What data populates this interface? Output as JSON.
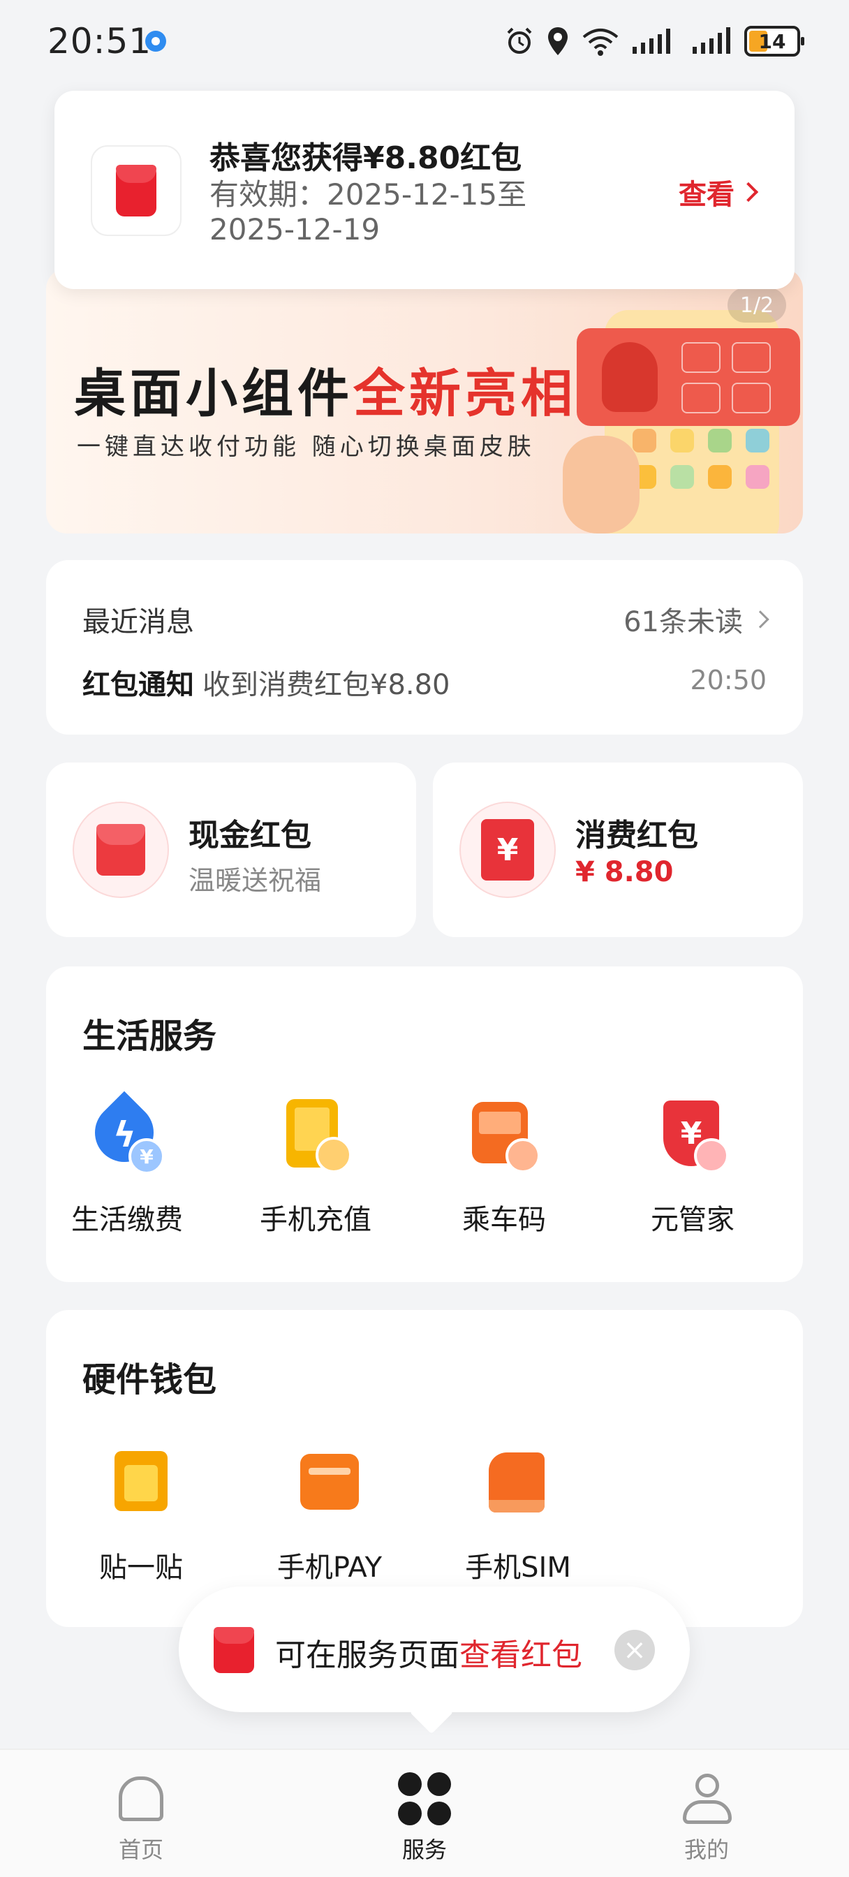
{
  "status_bar": {
    "time": "20:51",
    "battery": "14",
    "network": "6"
  },
  "notification": {
    "title": "恭喜您获得¥8.80红包",
    "validity": "有效期：2025-12-15至2025-12-19",
    "action": "查看"
  },
  "banner": {
    "title_black": "桌面小组件",
    "title_red": "全新亮相",
    "subtitle": "一键直达收付功能  随心切换桌面皮肤",
    "pager": "1/2",
    "colors": {
      "accent": "#e5332c"
    }
  },
  "messages": {
    "header": "最近消息",
    "unread": "61条未读",
    "latest_type": "红包通知",
    "latest_text": "收到消费红包¥8.80",
    "latest_time": "20:50"
  },
  "red_packets": {
    "cash": {
      "title": "现金红包",
      "subtitle": "温暖送祝福"
    },
    "consume": {
      "title": "消费红包",
      "amount": "¥ 8.80"
    }
  },
  "life_services": {
    "title": "生活服务",
    "items": [
      {
        "label": "生活缴费",
        "icon": "utility-payment-icon"
      },
      {
        "label": "手机充值",
        "icon": "mobile-recharge-icon"
      },
      {
        "label": "乘车码",
        "icon": "transit-code-icon"
      },
      {
        "label": "元管家",
        "icon": "finance-manager-icon"
      }
    ]
  },
  "hardware_wallet": {
    "title": "硬件钱包",
    "items": [
      {
        "label": "贴一贴",
        "icon": "tap-pay-icon"
      },
      {
        "label": "手机PAY",
        "icon": "phone-pay-icon"
      },
      {
        "label": "手机SIM",
        "icon": "sim-card-icon"
      }
    ]
  },
  "tip": {
    "text": "可在服务页面",
    "highlight": "查看红包"
  },
  "bottom_nav": [
    {
      "label": "首页",
      "icon": "home-icon",
      "active": false
    },
    {
      "label": "服务",
      "icon": "services-icon",
      "active": true
    },
    {
      "label": "我的",
      "icon": "profile-icon",
      "active": false
    }
  ]
}
